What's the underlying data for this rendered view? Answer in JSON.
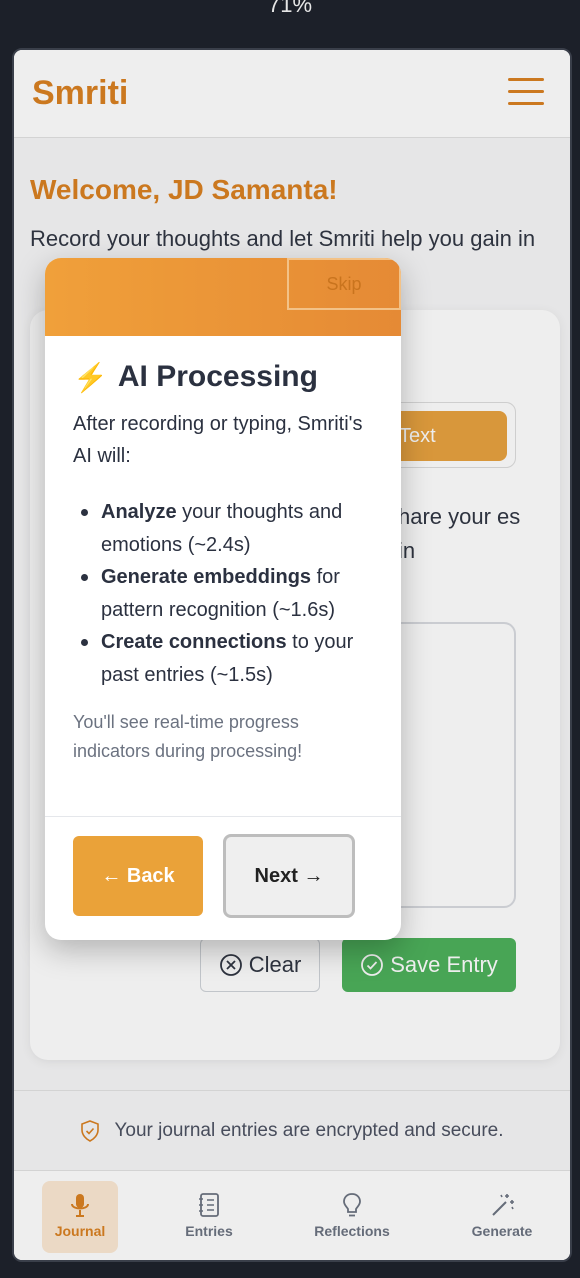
{
  "status": {
    "zoom_text": "71%"
  },
  "header": {
    "logo": "Smriti"
  },
  "welcome": {
    "title": "Welcome, JD Samanta!",
    "subtitle": "Record your thoughts and let Smriti help you gain in"
  },
  "card": {
    "mode_text_label": "Text",
    "description": "hare your es in",
    "clear_label": "Clear",
    "save_label": "Save Entry"
  },
  "footer": {
    "secure_text": "Your journal entries are encrypted and secure."
  },
  "nav": {
    "items": [
      {
        "label": "Journal",
        "icon": "microphone-icon",
        "active": true
      },
      {
        "label": "Entries",
        "icon": "notebook-icon",
        "active": false
      },
      {
        "label": "Reflections",
        "icon": "lightbulb-icon",
        "active": false
      },
      {
        "label": "Generate",
        "icon": "magic-wand-icon",
        "active": false
      }
    ]
  },
  "modal": {
    "skip_label": "Skip",
    "title": "AI Processing",
    "intro": "After recording or typing, Smriti's AI will:",
    "items": [
      {
        "bold": "Analyze",
        "rest": " your thoughts and emotions (~2.4s)"
      },
      {
        "bold": "Generate embeddings",
        "rest": " for pattern recognition (~1.6s)"
      },
      {
        "bold": "Create connections",
        "rest": " to your past entries (~1.5s)"
      }
    ],
    "note": "You'll see real-time progress indicators during processing!",
    "back_label": "← Back",
    "next_label": "Next →"
  },
  "colors": {
    "brand": "#d97f1f",
    "accent": "#e8a13d",
    "save": "#4bb05a",
    "background": "#1c2029"
  }
}
